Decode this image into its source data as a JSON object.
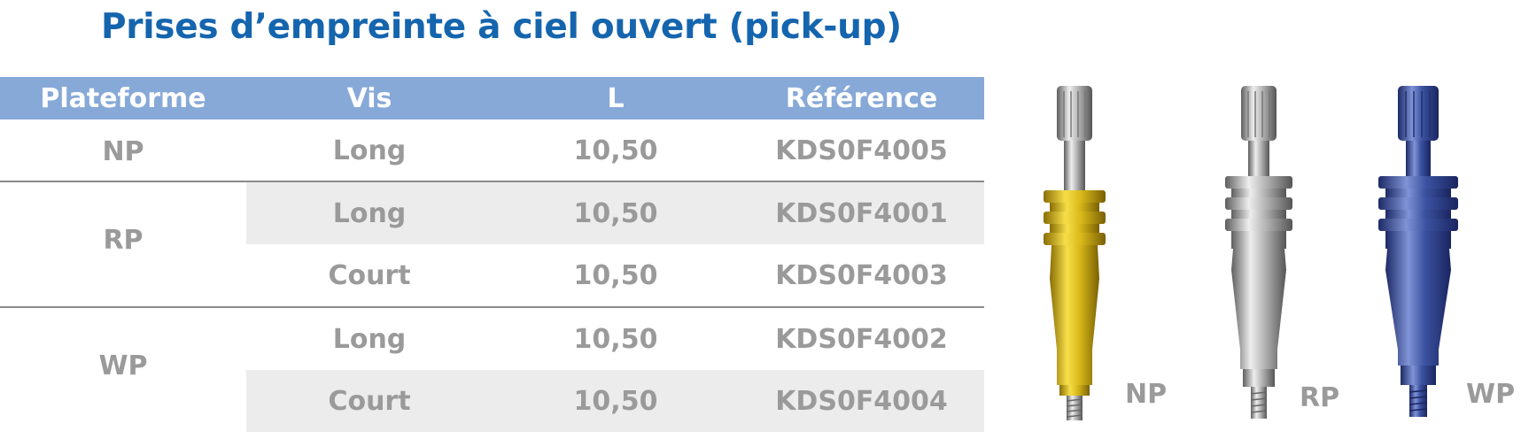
{
  "title": "Prises d’empreinte à ciel ouvert (pick-up)",
  "table": {
    "headers": [
      "Plateforme",
      "Vis",
      "L",
      "Référence"
    ],
    "groups": [
      {
        "platform": "NP",
        "rows": [
          {
            "vis": "Long",
            "l": "10,50",
            "ref": "KDS0F4005"
          }
        ]
      },
      {
        "platform": "RP",
        "rows": [
          {
            "vis": "Long",
            "l": "10,50",
            "ref": "KDS0F4001"
          },
          {
            "vis": "Court",
            "l": "10,50",
            "ref": "KDS0F4003"
          }
        ]
      },
      {
        "platform": "WP",
        "rows": [
          {
            "vis": "Long",
            "l": "10,50",
            "ref": "KDS0F4002"
          },
          {
            "vis": "Court",
            "l": "10,50",
            "ref": "KDS0F4004"
          }
        ]
      }
    ]
  },
  "products": [
    {
      "label": "NP",
      "color": "#d9b91a"
    },
    {
      "label": "RP",
      "color": "#a9a9a9"
    },
    {
      "label": "WP",
      "color": "#3b52a0"
    }
  ],
  "colors": {
    "title": "#1565ae",
    "header_bg": "#87a9d8",
    "cell_text": "#9a9a9a",
    "shade": "#ececec"
  }
}
